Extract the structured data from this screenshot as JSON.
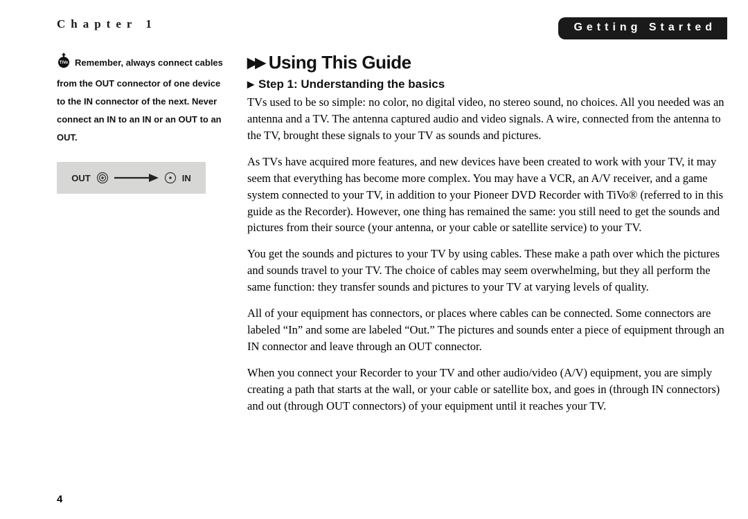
{
  "header": {
    "chapter_label": "Chapter 1",
    "tab_label": "Getting Started"
  },
  "sidebar": {
    "note": "Remember, always connect cables from the OUT connector of one device to the IN connector of the next. Never connect an IN to an IN or an OUT to an OUT.",
    "diagram": {
      "out_label": "OUT",
      "in_label": "IN"
    }
  },
  "main": {
    "title": "Using This Guide",
    "subtitle": "Step 1: Understanding the basics",
    "paragraphs": [
      "TVs used to be so simple: no color, no digital video, no stereo sound, no choices. All you needed was an antenna and a TV. The antenna captured audio and video signals. A wire, connected from the antenna to the TV, brought these signals to your TV as sounds and pictures.",
      "As TVs have acquired more features, and new devices have been created to work with your TV, it may seem that everything has become more complex. You may have a VCR, an A/V receiver, and a game system connected to your TV, in addition to your Pioneer DVD Recorder with TiVo® (referred to in this guide as the Recorder). However, one thing has remained the same: you still need to get the sounds and pictures from their source (your antenna, or your cable or satellite service) to your TV.",
      "You get the sounds and pictures to your TV by using cables. These make a path over which the pictures and sounds travel to your TV. The choice of cables may seem overwhelming, but they all perform the same function: they transfer sounds and pictures to your TV at varying levels of quality.",
      "All of your equipment has connectors, or places where cables can be connected. Some connectors are labeled “In” and some are labeled “Out.” The pictures and sounds enter a piece of equipment through an IN connector and leave through an OUT connector.",
      "When you connect your Recorder to your TV and other audio/video (A/V) equipment, you are simply creating a path that starts at the wall, or your cable or satellite box, and goes in (through IN connectors) and out (through OUT connectors) of your equipment until it reaches your TV."
    ]
  },
  "page_number": "4"
}
